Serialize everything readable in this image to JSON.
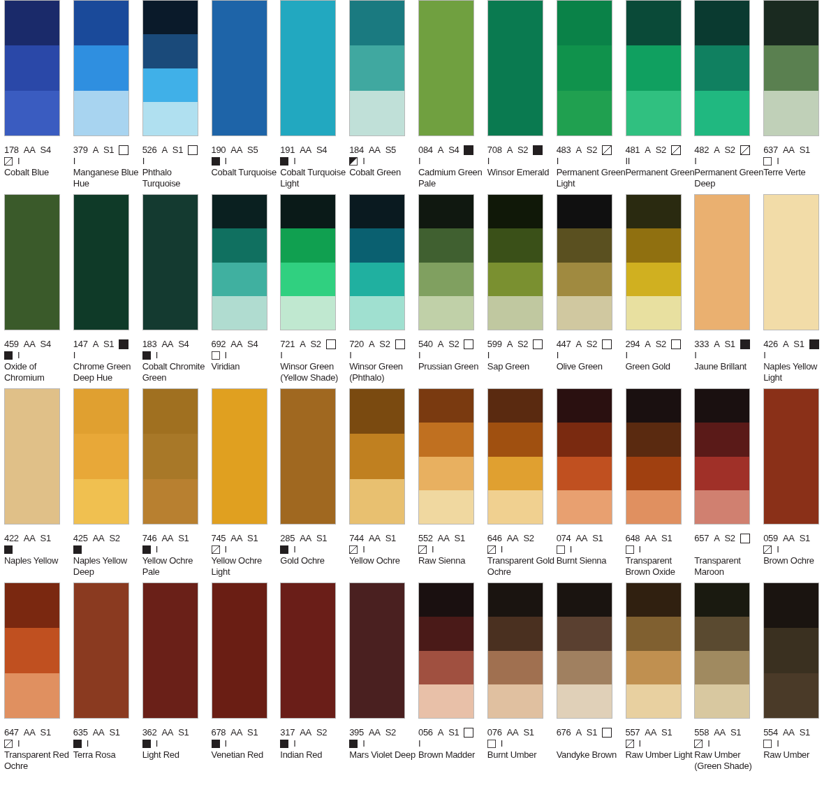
{
  "swatches": [
    {
      "code": "178",
      "permanence": "AA",
      "series": "S4",
      "kind": "semi_transparent",
      "icon_inline": false,
      "rating": "I",
      "name": "Cobalt Blue",
      "bands": [
        {
          "color": "#1a2a6a"
        },
        {
          "color": "#2a48a8"
        },
        {
          "color": "#3a5cc0"
        }
      ]
    },
    {
      "code": "379",
      "permanence": "A",
      "series": "S1",
      "kind": "transparent",
      "icon_inline": true,
      "rating": "I",
      "name": "Manganese Blue Hue",
      "bands": [
        {
          "color": "#1a4a9a"
        },
        {
          "color": "#2f8fe0"
        },
        {
          "color": "#a8d4f0"
        }
      ]
    },
    {
      "code": "526",
      "permanence": "A",
      "series": "S1",
      "kind": "transparent",
      "icon_inline": true,
      "rating": "I",
      "name": "Phthalo Turquoise",
      "bands": [
        {
          "color": "#0a1a2a"
        },
        {
          "color": "#1a4a7a"
        },
        {
          "color": "#40b0e8"
        },
        {
          "color": "#b0e0f0"
        }
      ]
    },
    {
      "code": "190",
      "permanence": "AA",
      "series": "S5",
      "kind": "opaque",
      "icon_inline": false,
      "rating": "I",
      "name": "Cobalt Turquoise",
      "bands": [
        {
          "color": "#1e64a8"
        }
      ]
    },
    {
      "code": "191",
      "permanence": "AA",
      "series": "S4",
      "kind": "opaque",
      "icon_inline": false,
      "rating": "I",
      "name": "Cobalt Turquoise Light",
      "bands": [
        {
          "color": "#22a8c0"
        }
      ]
    },
    {
      "code": "184",
      "permanence": "AA",
      "series": "S5",
      "kind": "semi_opaque",
      "icon_inline": false,
      "rating": "I",
      "name": "Cobalt Green",
      "bands": [
        {
          "color": "#1a7a80"
        },
        {
          "color": "#40a8a0"
        },
        {
          "color": "#c0e0d8"
        }
      ]
    },
    {
      "code": "084",
      "permanence": "A",
      "series": "S4",
      "kind": "opaque",
      "icon_inline": true,
      "rating": "I",
      "name": "Cadmium Green Pale",
      "bands": [
        {
          "color": "#70a040"
        }
      ]
    },
    {
      "code": "708",
      "permanence": "A",
      "series": "S2",
      "kind": "opaque",
      "icon_inline": true,
      "rating": "I",
      "name": "Winsor Emerald",
      "bands": [
        {
          "color": "#0a7a50"
        }
      ]
    },
    {
      "code": "483",
      "permanence": "A",
      "series": "S2",
      "kind": "semi_transparent",
      "icon_inline": true,
      "rating": "I",
      "name": "Permanent Green Light",
      "bands": [
        {
          "color": "#0a8248"
        },
        {
          "color": "#10924c"
        },
        {
          "color": "#20a050"
        }
      ]
    },
    {
      "code": "481",
      "permanence": "A",
      "series": "S2",
      "kind": "semi_transparent",
      "icon_inline": true,
      "rating": "II",
      "name": "Permanent Green",
      "bands": [
        {
          "color": "#0a4a38"
        },
        {
          "color": "#10a060"
        },
        {
          "color": "#30c080"
        }
      ]
    },
    {
      "code": "482",
      "permanence": "A",
      "series": "S2",
      "kind": "semi_transparent",
      "icon_inline": true,
      "rating": "I",
      "name": "Permanent Green Deep",
      "bands": [
        {
          "color": "#0a3a30"
        },
        {
          "color": "#108060"
        },
        {
          "color": "#20b880"
        }
      ]
    },
    {
      "code": "637",
      "permanence": "AA",
      "series": "S1",
      "kind": "transparent",
      "icon_inline": false,
      "rating": "I",
      "name": "Terre Verte",
      "bands": [
        {
          "color": "#1a2a20"
        },
        {
          "color": "#5a8050"
        },
        {
          "color": "#c0d0b8"
        }
      ]
    },
    {
      "code": "459",
      "permanence": "AA",
      "series": "S4",
      "kind": "opaque",
      "icon_inline": false,
      "rating": "I",
      "name": "Oxide of Chromium",
      "bands": [
        {
          "color": "#3a5a2a"
        }
      ]
    },
    {
      "code": "147",
      "permanence": "A",
      "series": "S1",
      "kind": "opaque",
      "icon_inline": true,
      "rating": "I",
      "name": "Chrome Green Deep Hue",
      "bands": [
        {
          "color": "#0f3a28"
        }
      ]
    },
    {
      "code": "183",
      "permanence": "AA",
      "series": "S4",
      "kind": "opaque",
      "icon_inline": false,
      "rating": "I",
      "name": "Cobalt Chromite Green",
      "bands": [
        {
          "color": "#143a30"
        }
      ]
    },
    {
      "code": "692",
      "permanence": "AA",
      "series": "S4",
      "kind": "transparent",
      "icon_inline": false,
      "rating": "I",
      "name": "Viridian",
      "bands": [
        {
          "color": "#0a2020"
        },
        {
          "color": "#107060"
        },
        {
          "color": "#40b0a0"
        },
        {
          "color": "#b0dcd0"
        }
      ]
    },
    {
      "code": "721",
      "permanence": "A",
      "series": "S2",
      "kind": "transparent",
      "icon_inline": true,
      "rating": "I",
      "name": "Winsor Green (Yellow Shade)",
      "bands": [
        {
          "color": "#0a1a18"
        },
        {
          "color": "#10a050"
        },
        {
          "color": "#30d080"
        },
        {
          "color": "#c0e8d0"
        }
      ]
    },
    {
      "code": "720",
      "permanence": "A",
      "series": "S2",
      "kind": "transparent",
      "icon_inline": true,
      "rating": "I",
      "name": "Winsor Green (Phthalo)",
      "bands": [
        {
          "color": "#0a1a20"
        },
        {
          "color": "#0a6070"
        },
        {
          "color": "#20b0a0"
        },
        {
          "color": "#a0e0d0"
        }
      ]
    },
    {
      "code": "540",
      "permanence": "A",
      "series": "S2",
      "kind": "transparent",
      "icon_inline": true,
      "rating": "I",
      "name": "Prussian Green",
      "bands": [
        {
          "color": "#101810"
        },
        {
          "color": "#406030"
        },
        {
          "color": "#80a060"
        },
        {
          "color": "#c0d0a8"
        }
      ]
    },
    {
      "code": "599",
      "permanence": "A",
      "series": "S2",
      "kind": "transparent",
      "icon_inline": true,
      "rating": "I",
      "name": "Sap Green",
      "bands": [
        {
          "color": "#101808"
        },
        {
          "color": "#3a5018"
        },
        {
          "color": "#7a9030"
        },
        {
          "color": "#c0c8a0"
        }
      ]
    },
    {
      "code": "447",
      "permanence": "A",
      "series": "S2",
      "kind": "transparent",
      "icon_inline": true,
      "rating": "I",
      "name": "Olive Green",
      "bands": [
        {
          "color": "#101010"
        },
        {
          "color": "#5a5020"
        },
        {
          "color": "#a08a40"
        },
        {
          "color": "#d0c8a0"
        }
      ]
    },
    {
      "code": "294",
      "permanence": "A",
      "series": "S2",
      "kind": "transparent",
      "icon_inline": true,
      "rating": "I",
      "name": "Green Gold",
      "bands": [
        {
          "color": "#2a2a10"
        },
        {
          "color": "#907010"
        },
        {
          "color": "#d0b020"
        },
        {
          "color": "#e8e0a0"
        }
      ]
    },
    {
      "code": "333",
      "permanence": "A",
      "series": "S1",
      "kind": "opaque",
      "icon_inline": true,
      "rating": "I",
      "name": "Jaune Brillant",
      "bands": [
        {
          "color": "#eab070"
        }
      ]
    },
    {
      "code": "426",
      "permanence": "A",
      "series": "S1",
      "kind": "opaque",
      "icon_inline": true,
      "rating": "I",
      "name": "Naples Yellow Light",
      "bands": [
        {
          "color": "#f2dca8"
        }
      ]
    },
    {
      "code": "422",
      "permanence": "AA",
      "series": "S1",
      "kind": "opaque",
      "icon_inline": false,
      "name": "Naples Yellow",
      "bands": [
        {
          "color": "#e0c088"
        }
      ]
    },
    {
      "code": "425",
      "permanence": "AA",
      "series": "S2",
      "kind": "opaque",
      "icon_inline": false,
      "name": "Naples Yellow Deep",
      "bands": [
        {
          "color": "#e0a030"
        },
        {
          "color": "#e8a838"
        },
        {
          "color": "#f0c050"
        }
      ]
    },
    {
      "code": "746",
      "permanence": "AA",
      "series": "S1",
      "kind": "opaque",
      "icon_inline": false,
      "rating": "I",
      "name": "Yellow Ochre Pale",
      "bands": [
        {
          "color": "#a07020"
        },
        {
          "color": "#a87828"
        },
        {
          "color": "#b88030"
        }
      ]
    },
    {
      "code": "745",
      "permanence": "AA",
      "series": "S1",
      "kind": "semi_transparent",
      "icon_inline": false,
      "rating": "I",
      "name": "Yellow Ochre Light",
      "bands": [
        {
          "color": "#e0a020"
        }
      ]
    },
    {
      "code": "285",
      "permanence": "AA",
      "series": "S1",
      "kind": "opaque",
      "icon_inline": false,
      "rating": "I",
      "name": "Gold Ochre",
      "bands": [
        {
          "color": "#a06820"
        }
      ]
    },
    {
      "code": "744",
      "permanence": "AA",
      "series": "S1",
      "kind": "semi_transparent",
      "icon_inline": false,
      "rating": "I",
      "name": "Yellow Ochre",
      "bands": [
        {
          "color": "#7a4a10"
        },
        {
          "color": "#c08020"
        },
        {
          "color": "#e8c070"
        }
      ]
    },
    {
      "code": "552",
      "permanence": "AA",
      "series": "S1",
      "kind": "semi_transparent",
      "icon_inline": false,
      "rating": "I",
      "name": "Raw Sienna",
      "bands": [
        {
          "color": "#7a3a10"
        },
        {
          "color": "#c07020"
        },
        {
          "color": "#e8b060"
        },
        {
          "color": "#f0d8a0"
        }
      ]
    },
    {
      "code": "646",
      "permanence": "AA",
      "series": "S2",
      "kind": "semi_transparent",
      "icon_inline": false,
      "rating": "I",
      "name": "Transparent Gold Ochre",
      "bands": [
        {
          "color": "#5a2a10"
        },
        {
          "color": "#a05010"
        },
        {
          "color": "#e0a030"
        },
        {
          "color": "#f0d090"
        }
      ]
    },
    {
      "code": "074",
      "permanence": "AA",
      "series": "S1",
      "kind": "transparent",
      "icon_inline": false,
      "rating": "I",
      "name": "Burnt Sienna",
      "bands": [
        {
          "color": "#2a1010"
        },
        {
          "color": "#7a2a10"
        },
        {
          "color": "#c05020"
        },
        {
          "color": "#e8a070"
        }
      ]
    },
    {
      "code": "648",
      "permanence": "AA",
      "series": "S1",
      "kind": "transparent",
      "icon_inline": false,
      "rating": "I",
      "name": "Transparent Brown Oxide",
      "bands": [
        {
          "color": "#1a1010"
        },
        {
          "color": "#5a2a10"
        },
        {
          "color": "#a04010"
        },
        {
          "color": "#e09060"
        }
      ]
    },
    {
      "code": "657",
      "permanence": "A",
      "series": "S2",
      "kind": "transparent",
      "icon_inline": true,
      "name": "Transparent Maroon",
      "bands": [
        {
          "color": "#1a1010"
        },
        {
          "color": "#5a1a18"
        },
        {
          "color": "#a03028"
        },
        {
          "color": "#d08070"
        }
      ]
    },
    {
      "code": "059",
      "permanence": "AA",
      "series": "S1",
      "kind": "semi_transparent",
      "icon_inline": false,
      "rating": "I",
      "name": "Brown Ochre",
      "bands": [
        {
          "color": "#8a3018"
        }
      ]
    },
    {
      "code": "647",
      "permanence": "AA",
      "series": "S1",
      "kind": "semi_transparent",
      "icon_inline": false,
      "rating": "I",
      "name": "Transparent Red Ochre",
      "bands": [
        {
          "color": "#7a2810"
        },
        {
          "color": "#c05020"
        },
        {
          "color": "#e09060"
        }
      ]
    },
    {
      "code": "635",
      "permanence": "AA",
      "series": "S1",
      "kind": "opaque",
      "icon_inline": false,
      "rating": "I",
      "name": "Terra Rosa",
      "bands": [
        {
          "color": "#8a3a20"
        }
      ]
    },
    {
      "code": "362",
      "permanence": "AA",
      "series": "S1",
      "kind": "opaque",
      "icon_inline": false,
      "rating": "I",
      "name": "Light Red",
      "bands": [
        {
          "color": "#6a2018"
        }
      ]
    },
    {
      "code": "678",
      "permanence": "AA",
      "series": "S1",
      "kind": "opaque",
      "icon_inline": false,
      "rating": "I",
      "name": "Venetian Red",
      "bands": [
        {
          "color": "#6a1e14"
        }
      ]
    },
    {
      "code": "317",
      "permanence": "AA",
      "series": "S2",
      "kind": "opaque",
      "icon_inline": false,
      "rating": "I",
      "name": "Indian Red",
      "bands": [
        {
          "color": "#6a1e18"
        }
      ]
    },
    {
      "code": "395",
      "permanence": "AA",
      "series": "S2",
      "kind": "opaque",
      "icon_inline": false,
      "rating": "I",
      "name": "Mars Violet Deep",
      "bands": [
        {
          "color": "#4a2020"
        }
      ]
    },
    {
      "code": "056",
      "permanence": "A",
      "series": "S1",
      "kind": "transparent",
      "icon_inline": true,
      "rating": "I",
      "name": "Brown Madder",
      "bands": [
        {
          "color": "#1a1010"
        },
        {
          "color": "#4a1a18"
        },
        {
          "color": "#a05040"
        },
        {
          "color": "#e8c0a8"
        }
      ]
    },
    {
      "code": "076",
      "permanence": "AA",
      "series": "S1",
      "kind": "transparent",
      "icon_inline": false,
      "rating": "I",
      "name": "Burnt Umber",
      "bands": [
        {
          "color": "#1a1410"
        },
        {
          "color": "#4a3020"
        },
        {
          "color": "#a07050"
        },
        {
          "color": "#e0c0a0"
        }
      ]
    },
    {
      "code": "676",
      "permanence": "A",
      "series": "S1",
      "kind": "transparent",
      "icon_inline": true,
      "name": "Vandyke Brown",
      "bands": [
        {
          "color": "#1a1410"
        },
        {
          "color": "#5a4030"
        },
        {
          "color": "#a08060"
        },
        {
          "color": "#e0d0b8"
        }
      ]
    },
    {
      "code": "557",
      "permanence": "AA",
      "series": "S1",
      "kind": "semi_transparent",
      "icon_inline": false,
      "rating": "I",
      "name": "Raw Umber Light",
      "bands": [
        {
          "color": "#302010"
        },
        {
          "color": "#806030"
        },
        {
          "color": "#c09050"
        },
        {
          "color": "#e8d0a0"
        }
      ]
    },
    {
      "code": "558",
      "permanence": "AA",
      "series": "S1",
      "kind": "semi_transparent",
      "icon_inline": false,
      "rating": "I",
      "name": "Raw Umber (Green Shade)",
      "bands": [
        {
          "color": "#1a1a10"
        },
        {
          "color": "#5a4a30"
        },
        {
          "color": "#a08a60"
        },
        {
          "color": "#d8c8a0"
        }
      ]
    },
    {
      "code": "554",
      "permanence": "AA",
      "series": "S1",
      "kind": "transparent",
      "icon_inline": false,
      "rating": "I",
      "name": "Raw Umber",
      "bands": [
        {
          "color": "#1a1410"
        },
        {
          "color": "#3a3020"
        },
        {
          "color": "#4a3a28"
        }
      ]
    }
  ]
}
